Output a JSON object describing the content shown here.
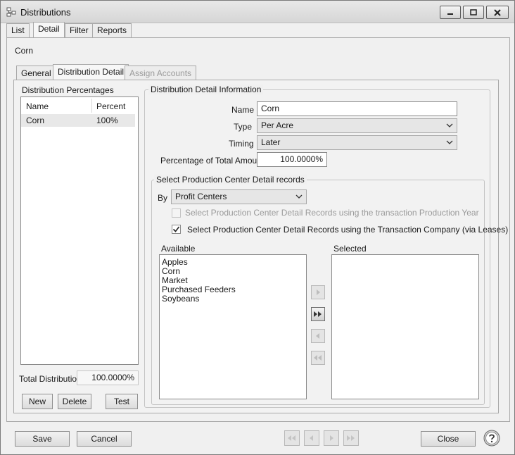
{
  "window": {
    "title": "Distributions"
  },
  "main_tabs": [
    {
      "label": "List"
    },
    {
      "label": "Detail"
    },
    {
      "label": "Filter"
    },
    {
      "label": "Reports"
    }
  ],
  "record_name": "Corn",
  "sub_tabs": [
    {
      "label": "General"
    },
    {
      "label": "Distribution Detail"
    },
    {
      "label": "Assign Accounts"
    }
  ],
  "percentages": {
    "group_title": "Distribution Percentages",
    "columns": [
      "Name",
      "Percent"
    ],
    "rows": [
      {
        "name": "Corn",
        "percent": "100%"
      }
    ],
    "total_label": "Total Distribution",
    "total_value": "100.0000%",
    "buttons": {
      "new": "New",
      "delete": "Delete",
      "test": "Test"
    }
  },
  "detail_info": {
    "group_title": "Distribution Detail Information",
    "name_label": "Name",
    "name_value": "Corn",
    "type_label": "Type",
    "type_value": "Per Acre",
    "timing_label": "Timing",
    "timing_value": "Later",
    "pct_label": "Percentage of Total Amount",
    "pct_value": "100.0000%"
  },
  "prod_center": {
    "group_title": "Select Production Center Detail records",
    "by_label": "By",
    "by_value": "Profit Centers",
    "check_year_label": "Select Production Center Detail Records using the transaction Production Year",
    "check_year_checked": false,
    "check_company_label": "Select Production Center Detail Records using the Transaction Company (via Leases)",
    "check_company_checked": true,
    "available_label": "Available",
    "available_items": [
      "Apples",
      "Corn",
      "Market",
      "Purchased Feeders",
      "Soybeans"
    ],
    "selected_label": "Selected",
    "selected_items": []
  },
  "footer": {
    "save": "Save",
    "cancel": "Cancel",
    "close": "Close"
  },
  "icons": {
    "app": "distributions-icon",
    "minimize": "minimize-icon",
    "maximize": "maximize-icon",
    "close": "close-icon",
    "move_right": "move-right-icon",
    "move_all_right": "move-all-right-icon",
    "move_left": "move-left-icon",
    "move_all_left": "move-all-left-icon",
    "nav_first": "first-record-icon",
    "nav_prev": "previous-record-icon",
    "nav_next": "next-record-icon",
    "nav_last": "last-record-icon",
    "help": "help-icon"
  },
  "colors": {
    "window_bg": "#f0f0f0",
    "selected_row": "#e8e8e8",
    "disabled_text": "#9a9a9a"
  }
}
